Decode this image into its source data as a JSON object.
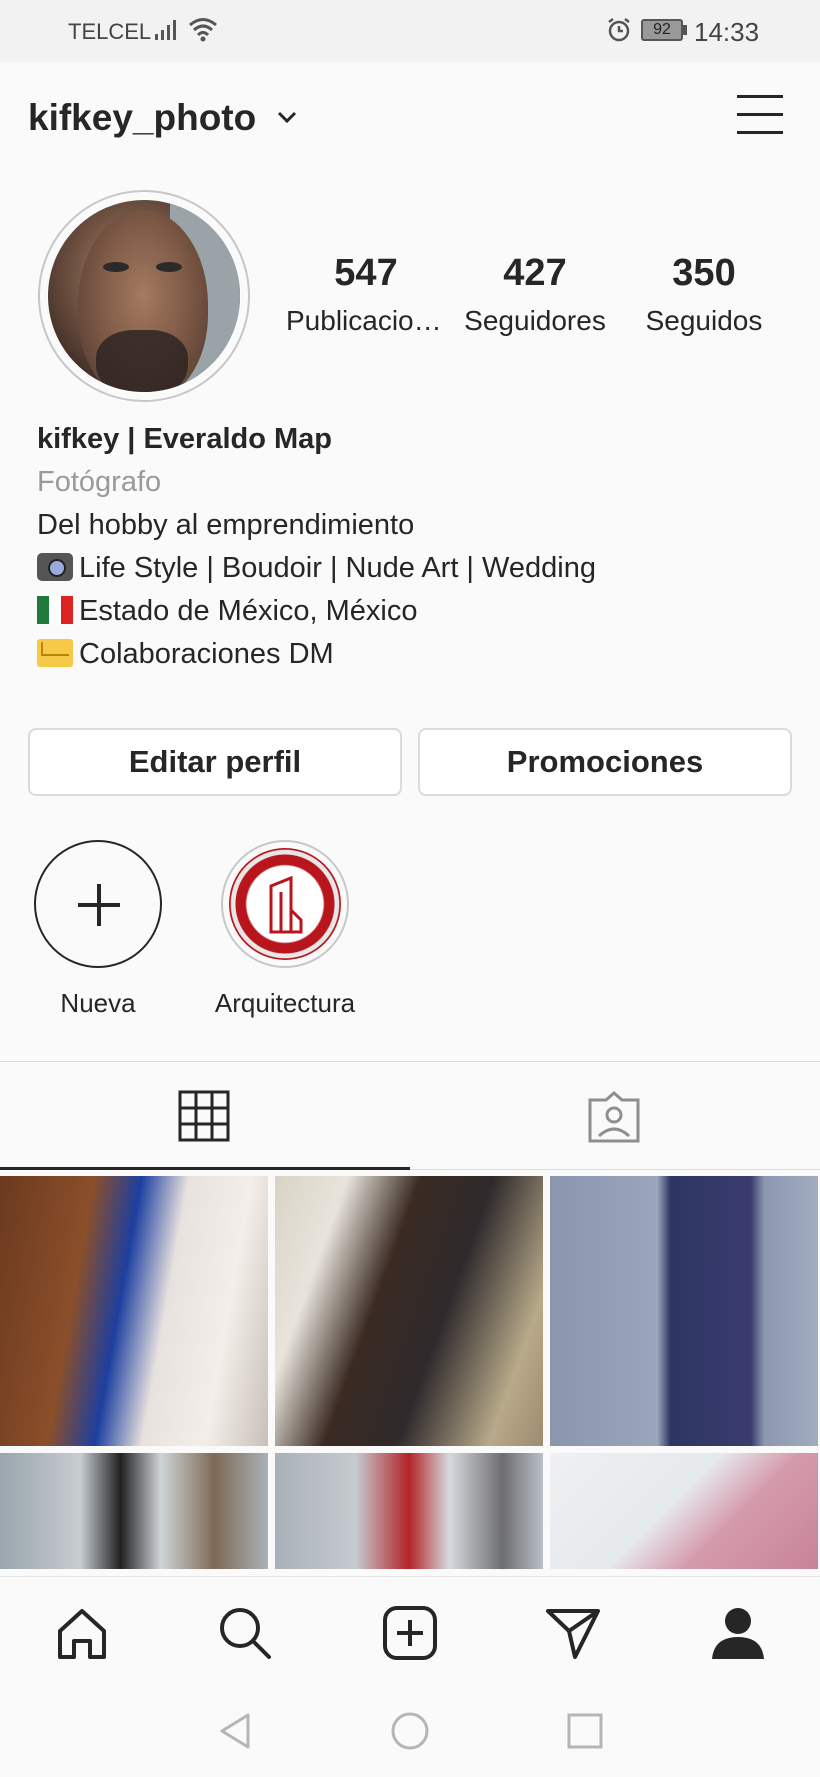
{
  "status_bar": {
    "carrier": "TELCEL",
    "battery": "92",
    "time": "14:33"
  },
  "header": {
    "username": "kifkey_photo"
  },
  "stats": [
    {
      "value": "547",
      "label": "Publicaciones"
    },
    {
      "value": "427",
      "label": "Seguidores"
    },
    {
      "value": "350",
      "label": "Seguidos"
    }
  ],
  "bio": {
    "name": "kifkey | Everaldo Map",
    "category": "Fotógrafo",
    "lines": [
      "Del hobby al emprendimiento",
      "Life Style | Boudoir | Nude Art | Wedding",
      "Estado de México, México",
      "Colaboraciones DM"
    ]
  },
  "buttons": {
    "edit_profile": "Editar perfil",
    "promotions": "Promociones"
  },
  "highlights": [
    {
      "label": "Nueva"
    },
    {
      "label": "Arquitectura"
    }
  ],
  "colors": {
    "text": "#262626",
    "muted": "#9a9a9a",
    "border": "#dbdbdb",
    "highlight_red": "#b8151c"
  }
}
